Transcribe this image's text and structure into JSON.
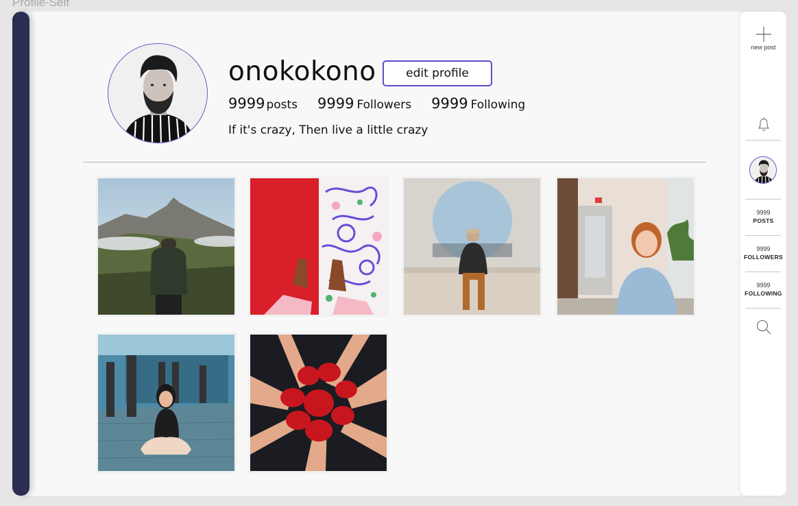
{
  "frame": {
    "label": "Profile-Self"
  },
  "profile": {
    "username": "onokokono",
    "edit_label": "edit profile",
    "posts_count": "9999",
    "posts_label": "posts",
    "followers_count": "9999",
    "followers_label": "Followers",
    "following_count": "9999",
    "following_label": "Following",
    "bio": "If it's crazy, Then live a little crazy"
  },
  "posts": [
    {
      "subject": "hiker on mountain ridge"
    },
    {
      "subject": "red carpet and doodle wall with shoes"
    },
    {
      "subject": "man seated in round window"
    },
    {
      "subject": "smiling woman in office"
    },
    {
      "subject": "woman sitting on station floor"
    },
    {
      "subject": "red painted hands in a circle"
    }
  ],
  "rightbar": {
    "new_post_label": "new post",
    "posts_count": "9999",
    "posts_label": "POSTS",
    "followers_count": "9999",
    "followers_label": "FOLLOWERS",
    "following_count": "9999",
    "following_label": "FOLLOWING"
  },
  "colors": {
    "accent": "#5b4fc9",
    "leftbar": "#2b2d52",
    "background": "#f8f8f8"
  }
}
